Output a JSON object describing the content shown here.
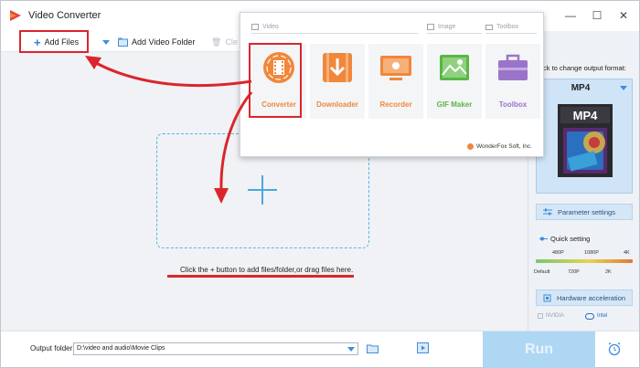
{
  "window": {
    "title": "Video Converter",
    "controls": {
      "minimize": "—",
      "maximize": "☐",
      "close": "✕"
    }
  },
  "toolbar": {
    "add_files": "Add Files",
    "add_video_folder": "Add Video Folder",
    "clear_partial": "Cle"
  },
  "main": {
    "hint": "Click the + button to add files/folder,or drag files here."
  },
  "popup": {
    "categories": {
      "video": "Video",
      "image": "Image",
      "toolbox": "Toolbox"
    },
    "tiles": [
      {
        "label": "Converter",
        "icon": "film-reel-icon",
        "color": "#f0873a"
      },
      {
        "label": "Downloader",
        "icon": "download-icon",
        "color": "#f0873a"
      },
      {
        "label": "Recorder",
        "icon": "screen-record-icon",
        "color": "#f0873a"
      },
      {
        "label": "GIF Maker",
        "icon": "image-icon",
        "color": "#5bb548"
      },
      {
        "label": "Toolbox",
        "icon": "toolbox-icon",
        "color": "#9b74c9"
      }
    ],
    "footer": "WonderFox Soft, Inc."
  },
  "right_panel": {
    "hint": "ck to change output format:",
    "format": "MP4",
    "format_icon_text": "MP4",
    "parameter_settings": "Parameter settings",
    "quick_setting": "Quick setting",
    "slider_top": [
      "480P",
      "1080P",
      "4K"
    ],
    "slider_bottom": [
      "Default",
      "720P",
      "2K"
    ],
    "hardware_acceleration": "Hardware acceleration",
    "nvidia": "NVIDIA",
    "intel": "Intel"
  },
  "bottom": {
    "output_label": "Output folder:",
    "output_path": "D:\\video and audio\\Movie Clips",
    "run": "Run"
  },
  "colors": {
    "accent": "#3b8ee0",
    "annotation_red": "#d9262c",
    "orange": "#f0873a",
    "green": "#5bb548",
    "purple": "#9b74c9"
  }
}
